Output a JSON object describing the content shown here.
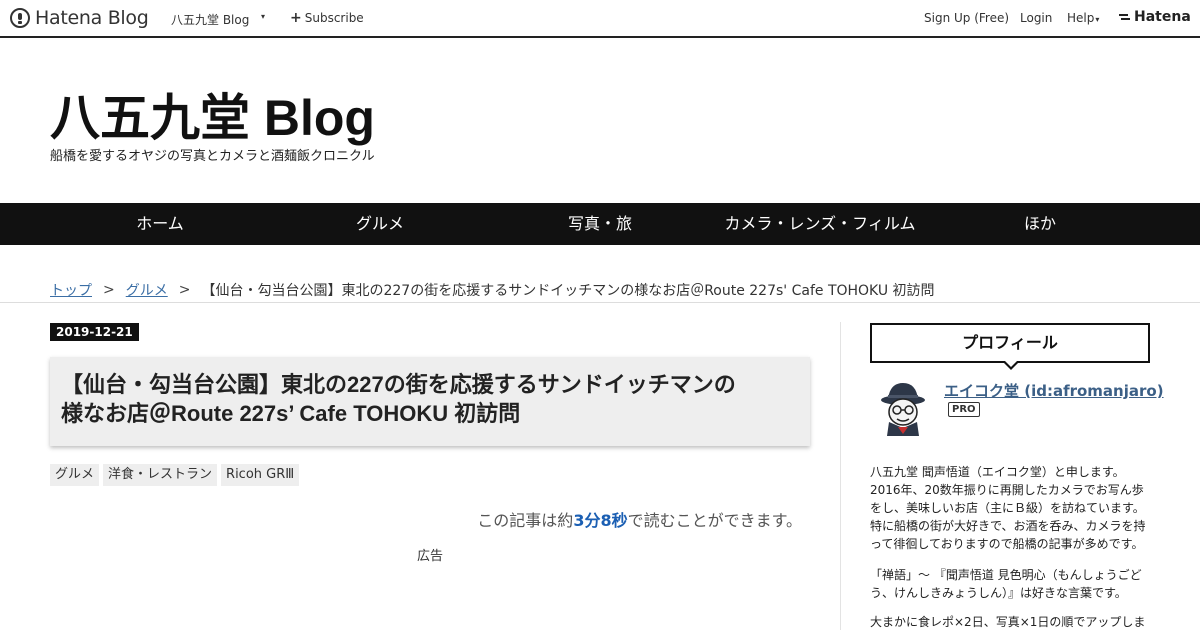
{
  "header": {
    "logo_text": "Hatena Blog",
    "blog_name": "八五九堂 Blog",
    "caret": "▾",
    "subscribe_icon": "plus-icon",
    "subscribe_label": "Subscribe",
    "signup_label": "Sign Up (Free)",
    "login_label": "Login",
    "help_label": "Help",
    "help_caret": "▾",
    "hatena_label": "Hatena"
  },
  "blog": {
    "title": "八五九堂 Blog",
    "description": "船橋を愛するオヤジの写真とカメラと酒麺飯クロニクル"
  },
  "nav": {
    "items": [
      {
        "label": "ホーム"
      },
      {
        "label": "グルメ"
      },
      {
        "label": "写真・旅"
      },
      {
        "label": "カメラ・レンズ・フィルム"
      },
      {
        "label": "ほか"
      }
    ]
  },
  "breadcrumb": {
    "top": "トップ",
    "category": "グルメ",
    "separator": ">",
    "current": "【仙台・勾当台公園】東北の227の街を応援するサンドイッチマンの様なお店＠Route 227s' Cafe TOHOKU 初訪問"
  },
  "entry": {
    "date": "2019-12-21",
    "title_line1": "【仙台・勾当台公園】東北の227の街を応援するサンドイッチマンの",
    "title_line2": "様なお店＠Route 227s’ Cafe TOHOKU 初訪問",
    "categories": [
      "グルメ",
      "洋食・レストラン",
      "Ricoh GRⅢ"
    ],
    "readtime_prefix": "この記事は約",
    "readtime_value": "3分8秒",
    "readtime_suffix": "で読むことができます。",
    "ad_label": "広告"
  },
  "sidebar": {
    "profile_heading": "プロフィール",
    "profile_name": "エイコク堂 (id:afromanjaro)",
    "pro_badge": "PRO",
    "avatar_icon": "avatar-hat-glasses-icon",
    "bio_lines_1": [
      "八五九堂 聞声悟道（エイコク堂）と申します。",
      "2016年、20数年振りに再開したカメラでお写ん歩",
      "をし、美味しいお店（主にＢ級）を訪ねています。",
      "特に船橋の街が大好きで、お酒を呑み、カメラを持",
      "って徘徊しておりますので船橋の記事が多めです。"
    ],
    "bio_lines_2": [
      "「禅語」～ 『聞声悟道 見色明心（もんしょうごど",
      "う、けんしきみょうしん）』は好きな言葉です。"
    ],
    "bio_lines_3": [
      "大まかに食レポ×2日、写真×1日の順でアップしま"
    ]
  }
}
